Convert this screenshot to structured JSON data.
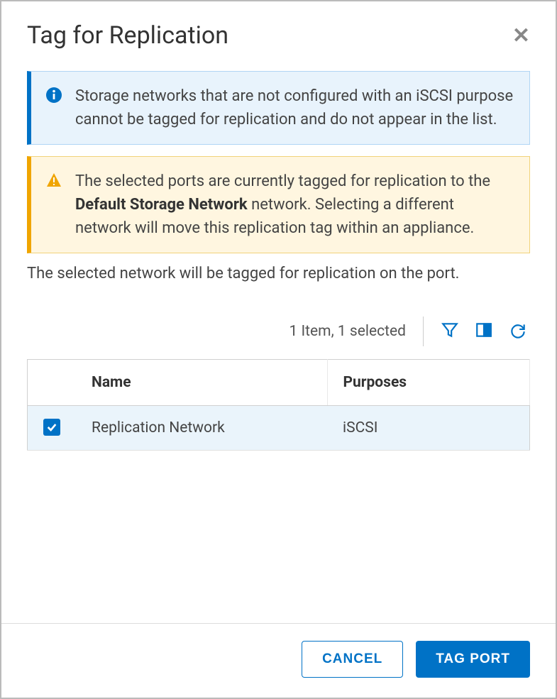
{
  "header": {
    "title": "Tag for Replication"
  },
  "alerts": {
    "info_text": "Storage networks that are not configured with an iSCSI purpose cannot be tagged for replication and do not appear in the list.",
    "warn_prefix": "The selected ports are currently tagged for replication to the ",
    "warn_bold": "Default Storage Network",
    "warn_suffix": " network. Selecting a different network will move this replication tag within an appliance."
  },
  "instruction": "The selected network will be tagged for replication on the port.",
  "toolbar": {
    "status": "1 Item, 1 selected"
  },
  "table": {
    "columns": {
      "name": "Name",
      "purposes": "Purposes"
    },
    "rows": [
      {
        "name": "Replication Network",
        "purposes": "iSCSI",
        "selected": true
      }
    ]
  },
  "footer": {
    "cancel": "CANCEL",
    "submit": "TAG PORT"
  },
  "colors": {
    "primary": "#0072c6",
    "warn": "#f0a500"
  }
}
